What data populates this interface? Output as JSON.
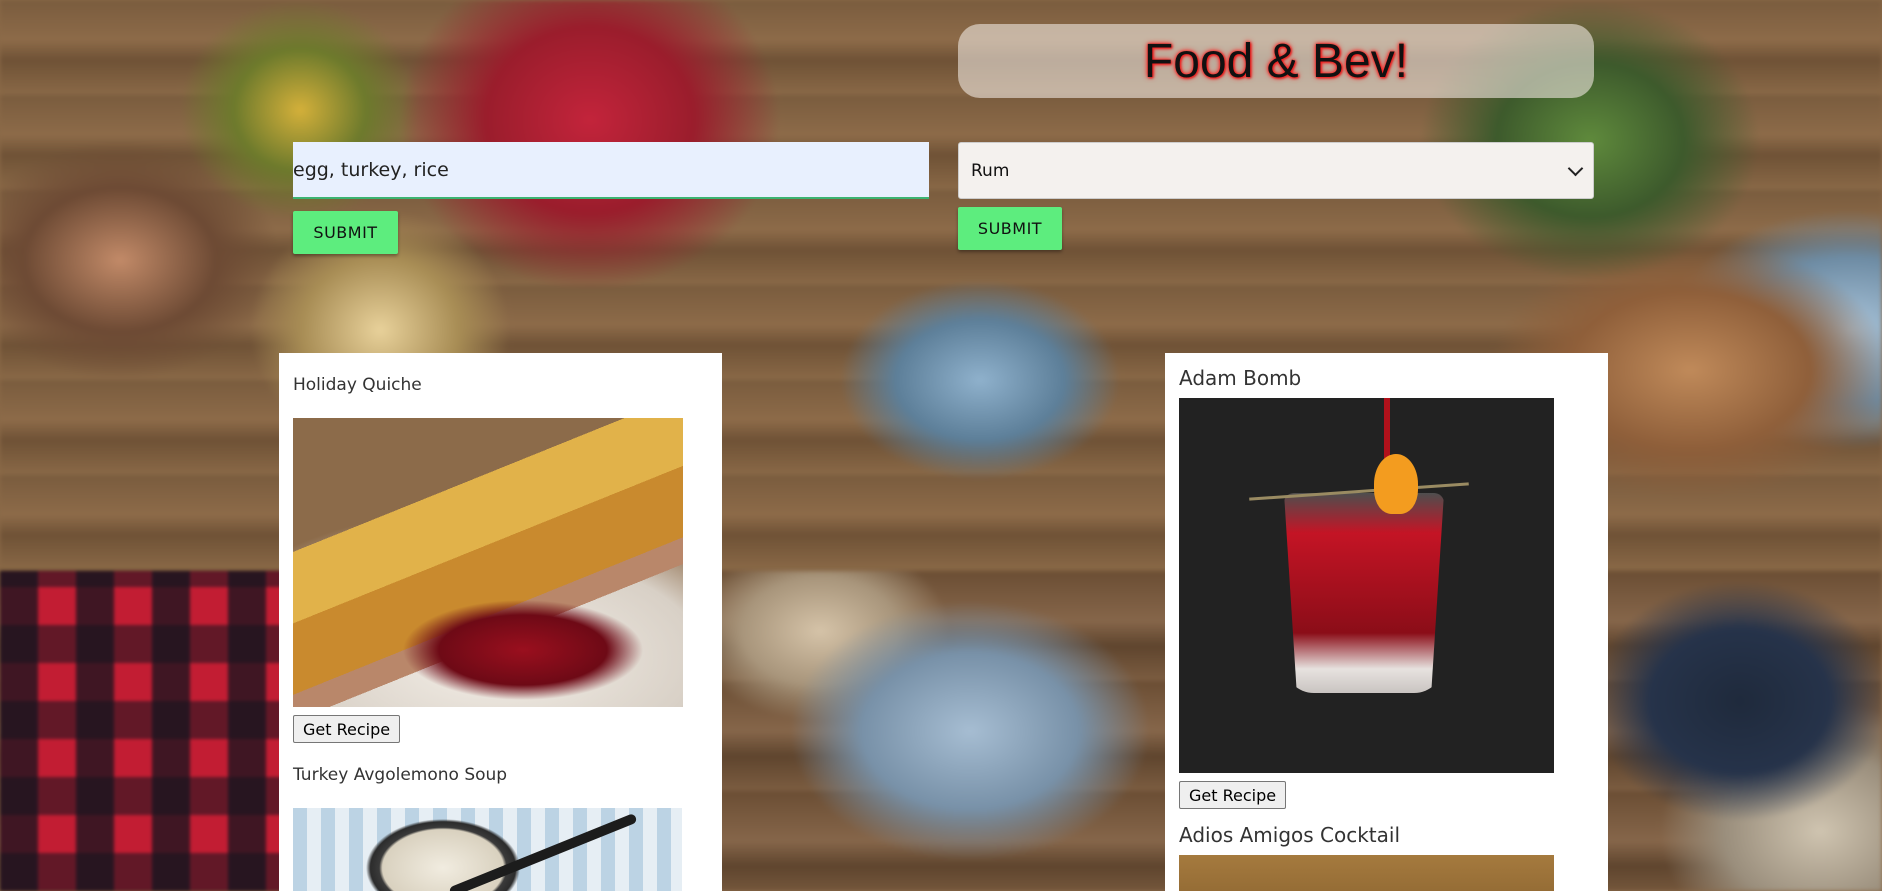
{
  "header": {
    "title": "Food & Bev!"
  },
  "food_search": {
    "value": "egg, turkey, rice",
    "submit_label": "SUBMIT"
  },
  "beverage_search": {
    "selected": "Rum",
    "submit_label": "SUBMIT"
  },
  "food_results": [
    {
      "title": "Holiday Quiche",
      "button": "Get Recipe"
    },
    {
      "title": "Turkey Avgolemono Soup"
    }
  ],
  "beverage_results": [
    {
      "title": "Adam Bomb",
      "button": "Get Recipe"
    },
    {
      "title": "Adios Amigos Cocktail"
    }
  ],
  "colors": {
    "submit_button": "#5ded7e",
    "title_glow": "#ff2020",
    "panel_bg": "#ffffff"
  }
}
